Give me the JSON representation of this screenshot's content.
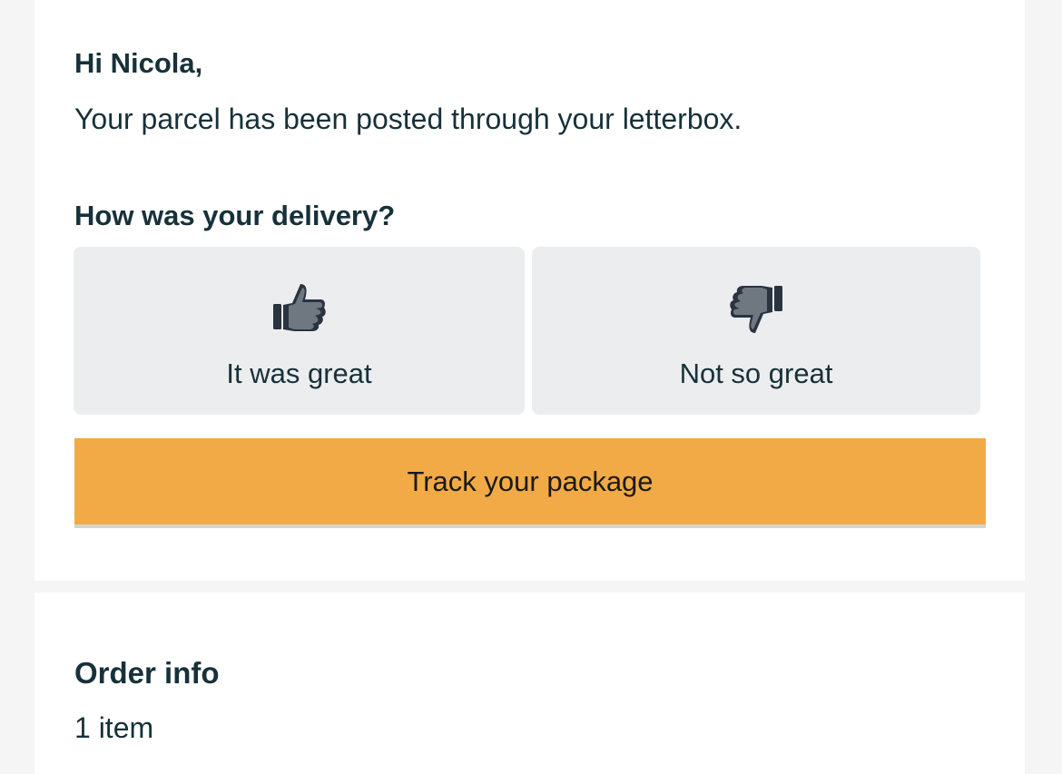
{
  "email": {
    "greeting": "Hi Nicola,",
    "message": "Your parcel has been posted through your letterbox.",
    "feedback": {
      "question": "How was your delivery?",
      "positive": {
        "label": "It was great",
        "icon": "thumbs-up-icon"
      },
      "negative": {
        "label": "Not so great",
        "icon": "thumbs-down-icon"
      }
    },
    "track_button": {
      "label": "Track your package",
      "color": "#f1aa45"
    }
  },
  "order": {
    "title": "Order info",
    "item_count": "1 item"
  },
  "colors": {
    "text": "#17313a",
    "feedback_bg": "#ecedef",
    "icon_dark": "#2a3340",
    "icon_light": "#6f7780",
    "page_bg": "#f5f5f5"
  }
}
